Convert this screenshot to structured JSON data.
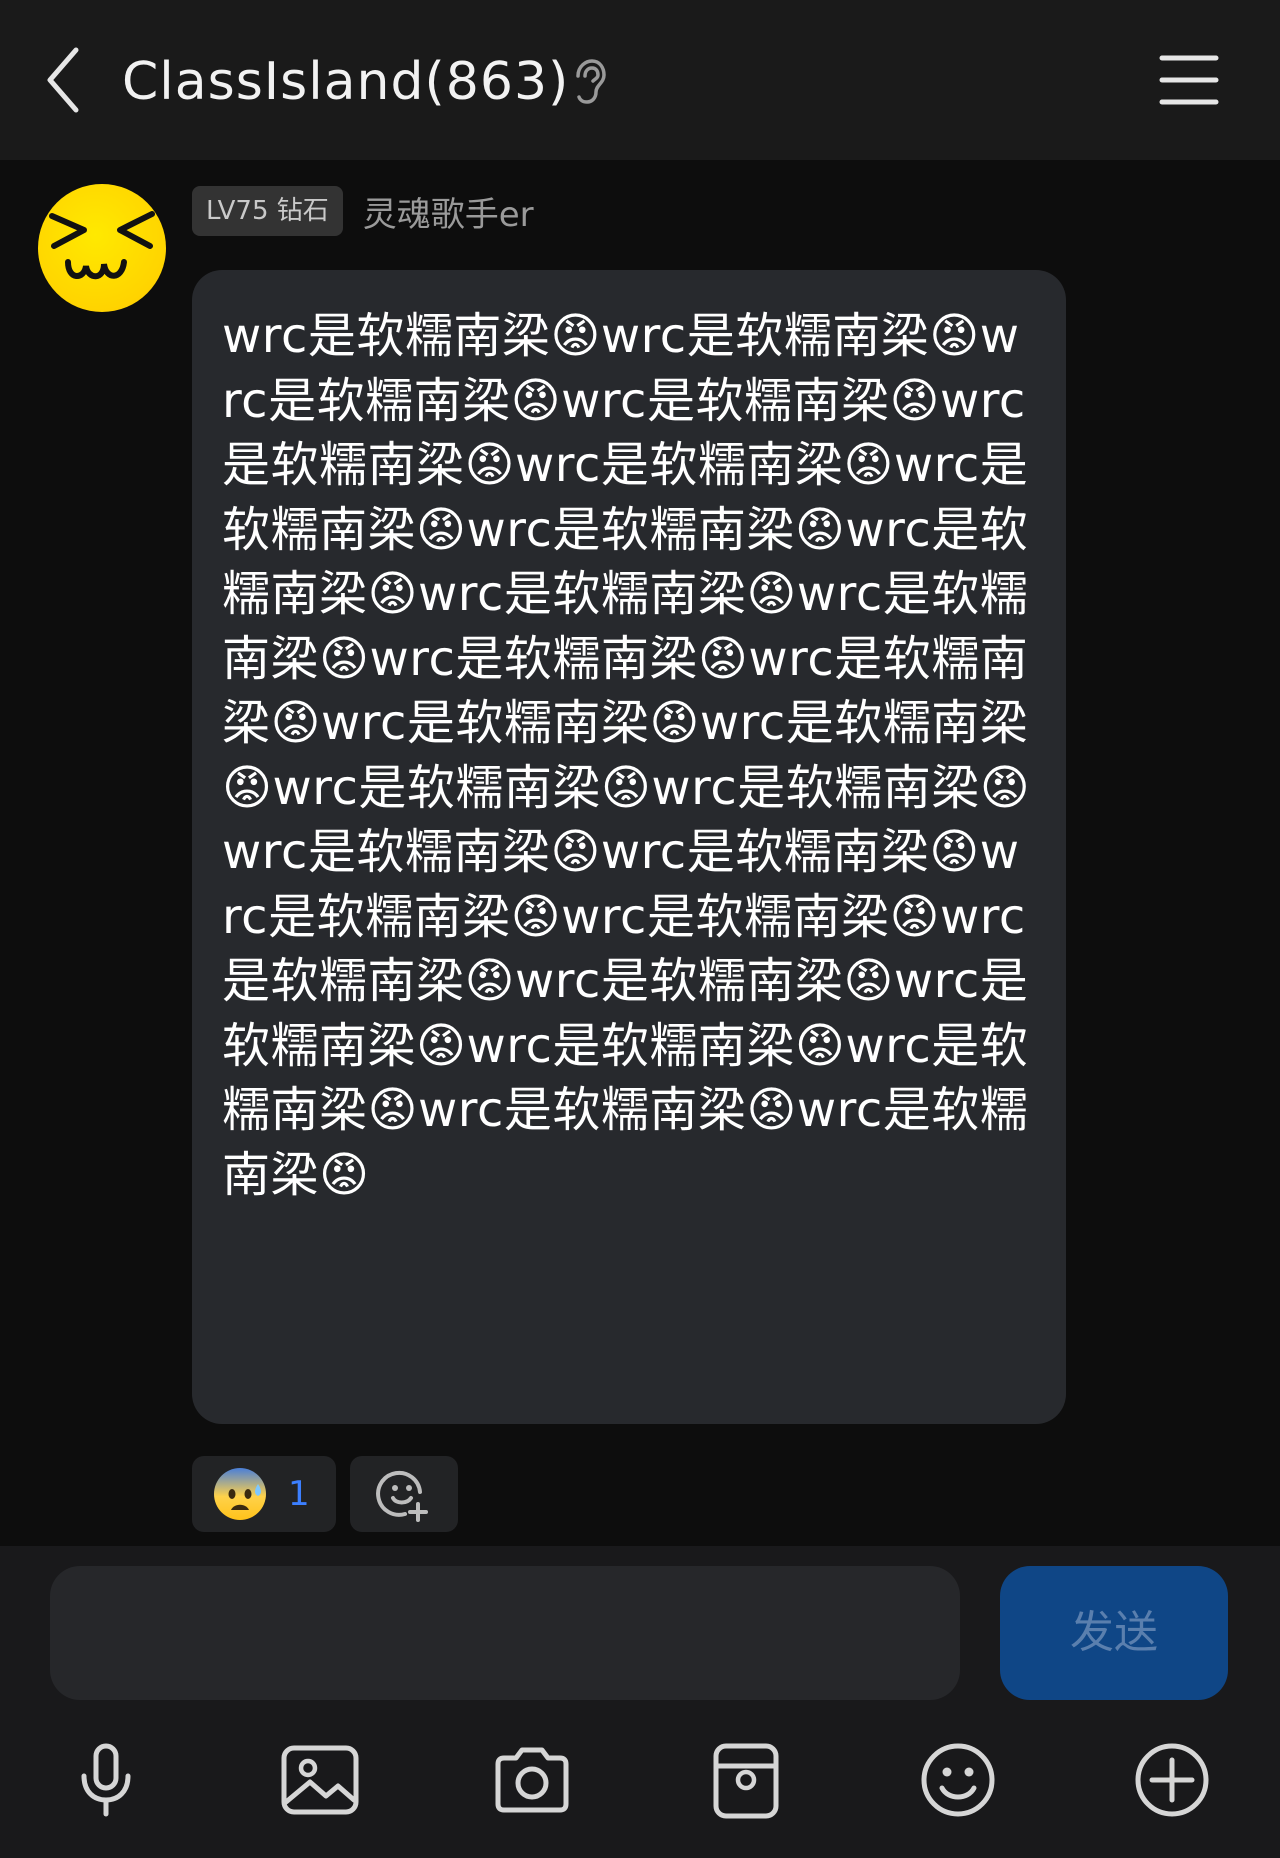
{
  "header": {
    "title": "ClassIsland(863)",
    "back_icon": "chevron-left-icon",
    "ear_icon": "ear-icon",
    "menu_icon": "hamburger-menu-icon"
  },
  "message": {
    "avatar": "squinting-laugh-face-avatar",
    "level_badge": "LV75 钻石",
    "username": "灵魂歌手er",
    "text": "wrc是软糯南梁😡wrc是软糯南梁😡wrc是软糯南梁😡wrc是软糯南梁😡wrc是软糯南梁😡wrc是软糯南梁😡wrc是软糯南梁😡wrc是软糯南梁😡wrc是软糯南梁😡wrc是软糯南梁😡wrc是软糯南梁😡wrc是软糯南梁😡wrc是软糯南梁😡wrc是软糯南梁😡wrc是软糯南梁😡wrc是软糯南梁😡wrc是软糯南梁😡wrc是软糯南梁😡wrc是软糯南梁😡wrc是软糯南梁😡wrc是软糯南梁😡wrc是软糯南梁😡wrc是软糯南梁😡wrc是软糯南梁😡wrc是软糯南梁😡wrc是软糯南梁😡wrc是软糯南梁😡wrc是软糯南梁😡",
    "reaction": {
      "emoji": "anxious-face-with-sweat-icon",
      "count": "1"
    },
    "add_reaction_icon": "add-reaction-icon"
  },
  "composer": {
    "placeholder": "",
    "send_label": "发送"
  },
  "toolbar": {
    "items": [
      "microphone-icon",
      "image-icon",
      "camera-icon",
      "sticker-icon",
      "emoji-icon",
      "plus-icon"
    ]
  },
  "colors": {
    "header_bg": "#1a1a1a",
    "chat_bg": "#0d0d0d",
    "bubble_bg": "#27292d",
    "send_bg": "#0f4686",
    "send_text": "#5a7fae",
    "reaction_count": "#3c7fff"
  }
}
